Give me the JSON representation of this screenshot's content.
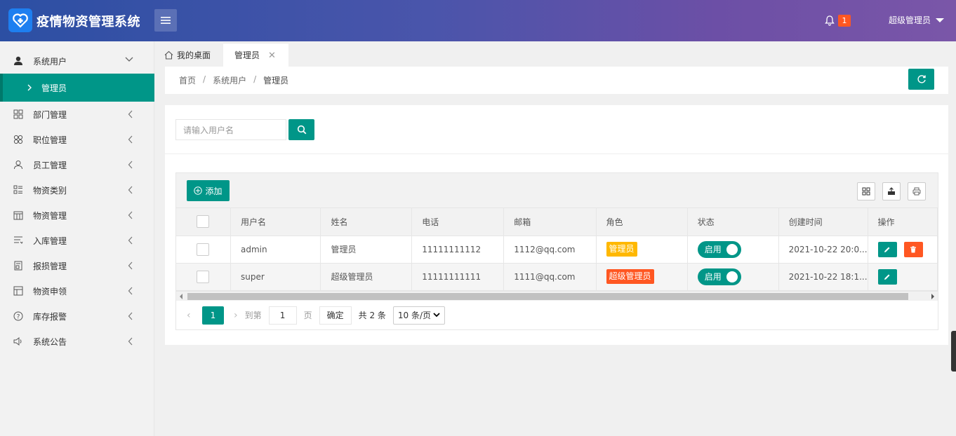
{
  "app": {
    "title": "疫情物资管理系统"
  },
  "header": {
    "notification_count": "1",
    "user_name": "超级管理员"
  },
  "sidebar": {
    "items": [
      {
        "label": "系统用户",
        "icon": "user-icon"
      },
      {
        "label": "部门管理",
        "icon": "grid-icon"
      },
      {
        "label": "职位管理",
        "icon": "clover-icon"
      },
      {
        "label": "员工管理",
        "icon": "person-icon"
      },
      {
        "label": "物资类别",
        "icon": "list-grid-icon"
      },
      {
        "label": "物资管理",
        "icon": "calendar-icon"
      },
      {
        "label": "入库管理",
        "icon": "list-icon"
      },
      {
        "label": "报损管理",
        "icon": "document-icon"
      },
      {
        "label": "物资申领",
        "icon": "table-icon"
      },
      {
        "label": "库存报警",
        "icon": "question-icon"
      },
      {
        "label": "系统公告",
        "icon": "speaker-icon"
      }
    ],
    "active_sub": "管理员"
  },
  "tabs": {
    "home": "我的桌面",
    "active": "管理员"
  },
  "breadcrumb": {
    "items": [
      "首页",
      "系统用户",
      "管理员"
    ]
  },
  "search": {
    "placeholder": "请输入用户名"
  },
  "toolbar": {
    "add_label": "添加"
  },
  "table": {
    "columns": [
      "用户名",
      "姓名",
      "电话",
      "邮箱",
      "角色",
      "状态",
      "创建时间",
      "操作"
    ],
    "rows": [
      {
        "username": "admin",
        "name": "管理员",
        "phone": "11111111112",
        "email": "1112@qq.com",
        "role": "管理员",
        "role_color": "#ffb800",
        "status": "启用",
        "created": "2021-10-22 20:0..."
      },
      {
        "username": "super",
        "name": "超级管理员",
        "phone": "11111111111",
        "email": "1111@qq.com",
        "role": "超级管理员",
        "role_color": "#ff5722",
        "status": "启用",
        "created": "2021-10-22 18:1..."
      }
    ]
  },
  "pager": {
    "current": "1",
    "goto_prefix": "到第",
    "goto_value": "1",
    "goto_suffix": "页",
    "confirm": "确定",
    "total": "共 2 条",
    "page_size": "10 条/页"
  },
  "colors": {
    "primary": "#009688",
    "danger": "#ff5722",
    "warning": "#ffb800"
  }
}
